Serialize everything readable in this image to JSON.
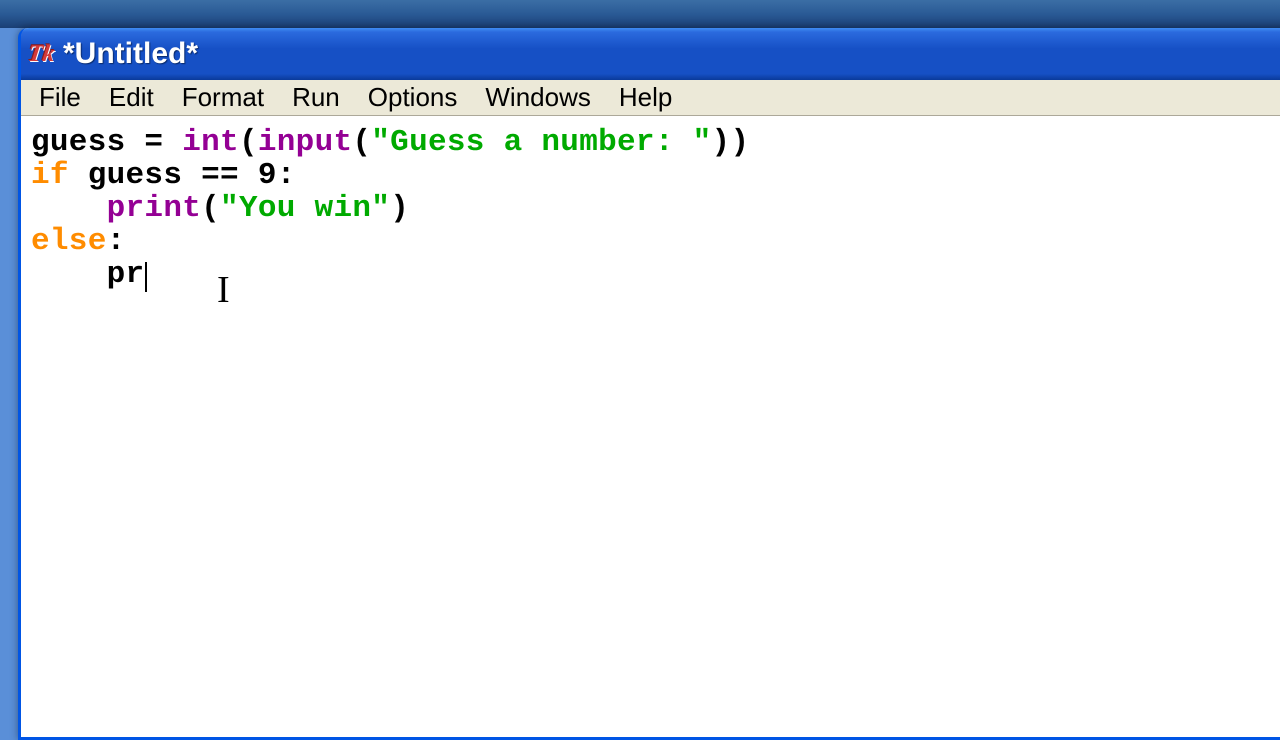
{
  "window": {
    "title": "*Untitled*",
    "icon_label": "Tk"
  },
  "menu": {
    "file": "File",
    "edit": "Edit",
    "format": "Format",
    "run": "Run",
    "options": "Options",
    "windows": "Windows",
    "help": "Help"
  },
  "code": {
    "line1": {
      "var": "guess = ",
      "int": "int",
      "p1": "(",
      "input": "input",
      "p2": "(",
      "str": "\"Guess a number: \"",
      "p3": "))"
    },
    "line2": {
      "if": "if",
      "rest": " guess == 9:"
    },
    "line3": {
      "indent": "    ",
      "print": "print",
      "p1": "(",
      "str": "\"You win\"",
      "p2": ")"
    },
    "line4": {
      "else": "else",
      "colon": ":"
    },
    "line5": {
      "indent": "    ",
      "partial": "pr"
    }
  }
}
